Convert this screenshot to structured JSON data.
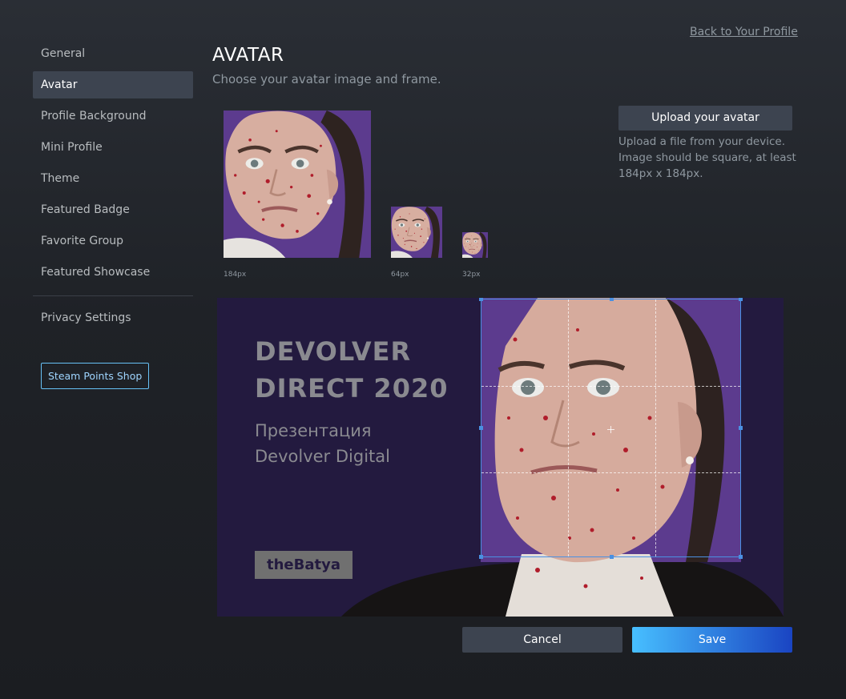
{
  "nav": {
    "items": [
      {
        "label": "General"
      },
      {
        "label": "Avatar"
      },
      {
        "label": "Profile Background"
      },
      {
        "label": "Mini Profile"
      },
      {
        "label": "Theme"
      },
      {
        "label": "Featured Badge"
      },
      {
        "label": "Favorite Group"
      },
      {
        "label": "Featured Showcase"
      }
    ],
    "privacy": "Privacy Settings",
    "points_shop": "Steam Points Shop"
  },
  "header": {
    "back_link": "Back to Your Profile",
    "title": "AVATAR",
    "subtitle": "Choose your avatar image and frame."
  },
  "previews": {
    "large": "184px",
    "medium": "64px",
    "small": "32px"
  },
  "upload": {
    "button": "Upload your avatar",
    "hint": "Upload a file from your device. Image should be square, at least 184px x 184px."
  },
  "banner": {
    "title_line1": "DEVOLVER",
    "title_line2": "DIRECT 2020",
    "sub_line1": "Презентация",
    "sub_line2": "Devolver Digital",
    "tag": "theBatya"
  },
  "actions": {
    "cancel": "Cancel",
    "save": "Save"
  },
  "colors": {
    "accent": "#47bfff",
    "crop_border": "#4a90e2",
    "avatar_bg": "#5c3b8e"
  }
}
